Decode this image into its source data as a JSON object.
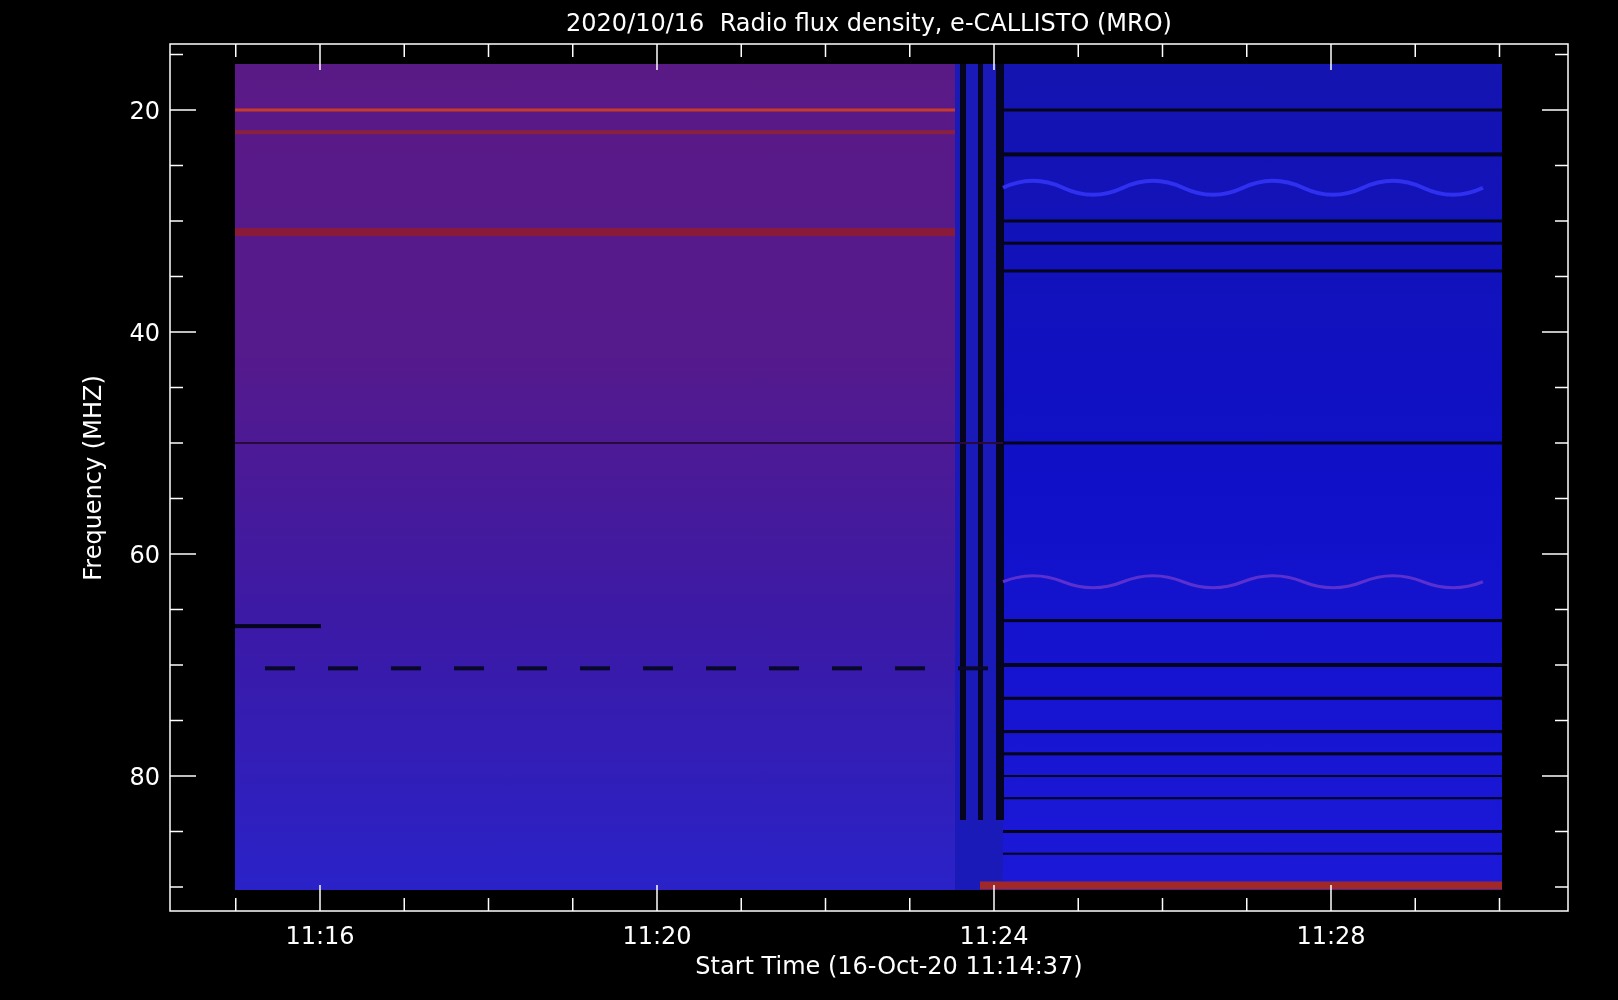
{
  "title": "2020/10/16  Radio flux density, e-CALLISTO (MRO)",
  "y_axis": {
    "label": "Frequency (MHZ)",
    "ticks": [
      "20",
      "40",
      "60",
      "80"
    ]
  },
  "x_axis": {
    "label": "Start Time (16-Oct-20 11:14:37)",
    "ticks": [
      "11:16",
      "11:20",
      "11:24",
      "11:28"
    ]
  }
}
